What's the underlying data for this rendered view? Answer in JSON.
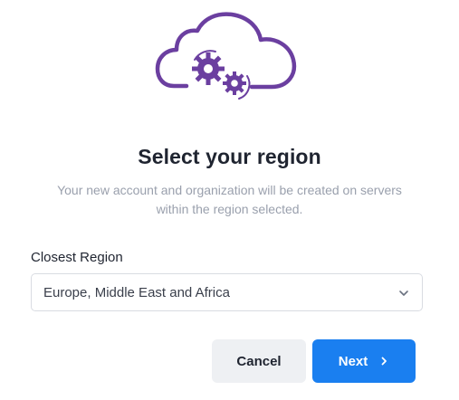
{
  "hero": {
    "icon": "cloud-gears-icon",
    "color": "#6b3fa0"
  },
  "title": "Select your region",
  "subtitle_line1": "Your new account and organization will be created on servers",
  "subtitle_line2": "within the region selected.",
  "region_field": {
    "label": "Closest Region",
    "selected_value": "Europe, Middle East and Africa"
  },
  "actions": {
    "cancel_label": "Cancel",
    "next_label": "Next"
  },
  "colors": {
    "accent": "#1a7ff0",
    "brand_purple": "#6b3fa0"
  }
}
